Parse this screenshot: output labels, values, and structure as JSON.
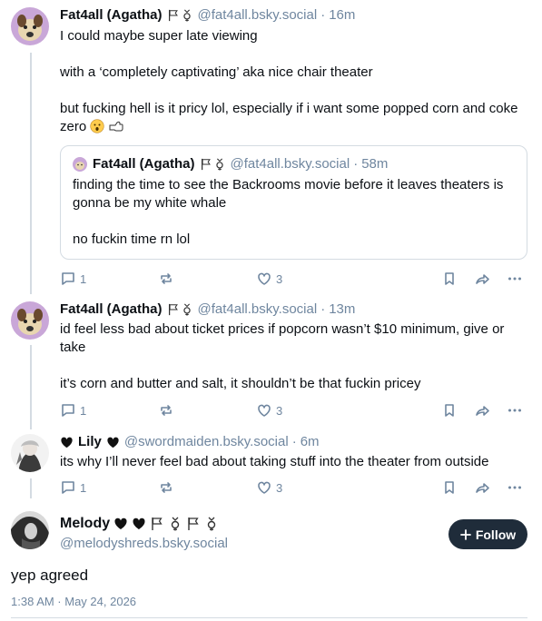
{
  "posts": [
    {
      "name": "Fat4all (Agatha)",
      "handle": "@fat4all.bsky.social",
      "time": "16m",
      "paragraphs": [
        "I could maybe super late viewing",
        "with a ‘completely captivating’ aka nice chair theater",
        "but fucking hell is it pricy lol, especially if i want some popped corn and coke zero"
      ],
      "quote": {
        "name": "Fat4all (Agatha)",
        "handle": "@fat4all.bsky.social",
        "time": "58m",
        "paragraphs": [
          "finding the time to see the Backrooms movie before it leaves theaters is gonna be my white whale",
          "no fuckin time rn lol"
        ]
      },
      "reply_count": "1",
      "like_count": "3"
    },
    {
      "name": "Fat4all (Agatha)",
      "handle": "@fat4all.bsky.social",
      "time": "13m",
      "paragraphs": [
        "id feel less bad about ticket prices if popcorn wasn’t $10 minimum, give or take",
        "it’s corn and butter and salt, it shouldn’t be that fuckin pricey"
      ],
      "reply_count": "1",
      "like_count": "3"
    },
    {
      "name": "Lily",
      "handle": "@swordmaiden.bsky.social",
      "time": "6m",
      "paragraphs": [
        "its why I’ll never feel bad about taking stuff into the theater from outside"
      ],
      "reply_count": "1",
      "like_count": "3"
    }
  ],
  "separator": "·",
  "main_post": {
    "name": "Melody",
    "handle": "@melodyshreds.bsky.social",
    "follow_label": "Follow",
    "text": "yep agreed",
    "timestamp": "1:38 AM · May 24, 2026"
  },
  "icons": {
    "reply": "reply-icon",
    "repost": "repost-icon",
    "like": "heart-icon",
    "bookmark": "bookmark-icon",
    "share": "share-icon",
    "more": "more-icon",
    "flag": "flag-icon",
    "gender": "genderfluid-symbol-icon",
    "heart_black": "black-heart-icon",
    "astonished": "astonished-face-emoji",
    "hand": "left-pointing-hand-emoji"
  },
  "colors": {
    "text": "#0b0f14",
    "muted": "#6f869f",
    "border": "#d4dbe2",
    "follow_bg": "#1f2c3a"
  }
}
